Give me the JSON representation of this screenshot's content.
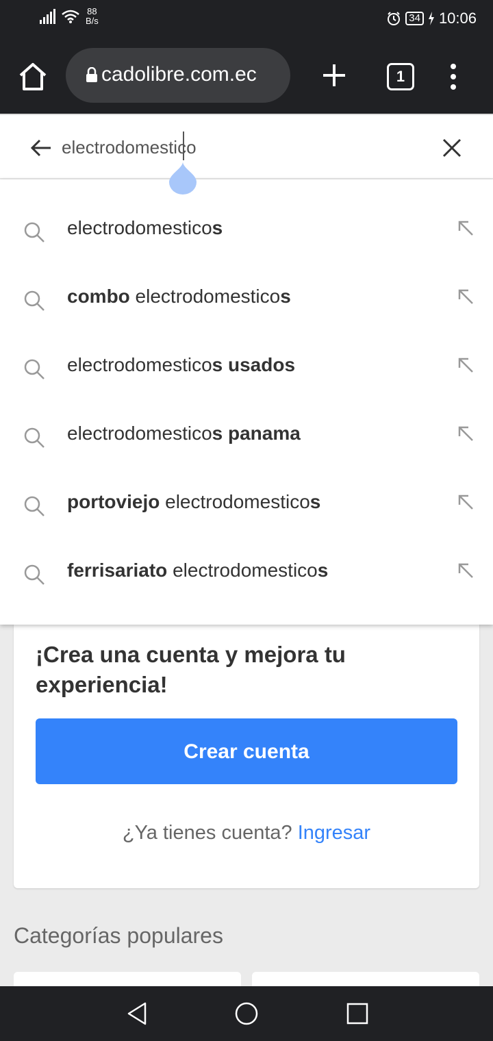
{
  "status_bar": {
    "net_speed_value": "88",
    "net_speed_unit": "B/s",
    "battery": "34",
    "time": "10:06"
  },
  "browser": {
    "url": "cadolibre.com.ec",
    "tab_count": "1"
  },
  "search": {
    "query_before_caret": "electrodome",
    "query_after_caret": "stico"
  },
  "suggestions": [
    {
      "pre": "",
      "prebold": "",
      "mid": "electrodomestico",
      "postbold": "s",
      "post": ""
    },
    {
      "pre": "",
      "prebold": "combo",
      "mid": " electrodomestico",
      "postbold": "s",
      "post": ""
    },
    {
      "pre": "",
      "prebold": "",
      "mid": "electrodomestico",
      "postbold": "s usados",
      "post": ""
    },
    {
      "pre": "",
      "prebold": "",
      "mid": "electrodomestico",
      "postbold": "s panama",
      "post": ""
    },
    {
      "pre": "",
      "prebold": "portoviejo",
      "mid": " electrodomestico",
      "postbold": "s",
      "post": ""
    },
    {
      "pre": "",
      "prebold": "ferrisariato",
      "mid": " electrodomestico",
      "postbold": "s",
      "post": ""
    }
  ],
  "account_card": {
    "title": "¡Crea una cuenta y mejora tu experiencia!",
    "button": "Crear cuenta",
    "login_prompt": "¿Ya tienes cuenta?",
    "login_link": "Ingresar"
  },
  "sections": {
    "popular_categories": "Categorías populares"
  },
  "colors": {
    "accent": "#3483fa",
    "toolbar": "#202124"
  }
}
